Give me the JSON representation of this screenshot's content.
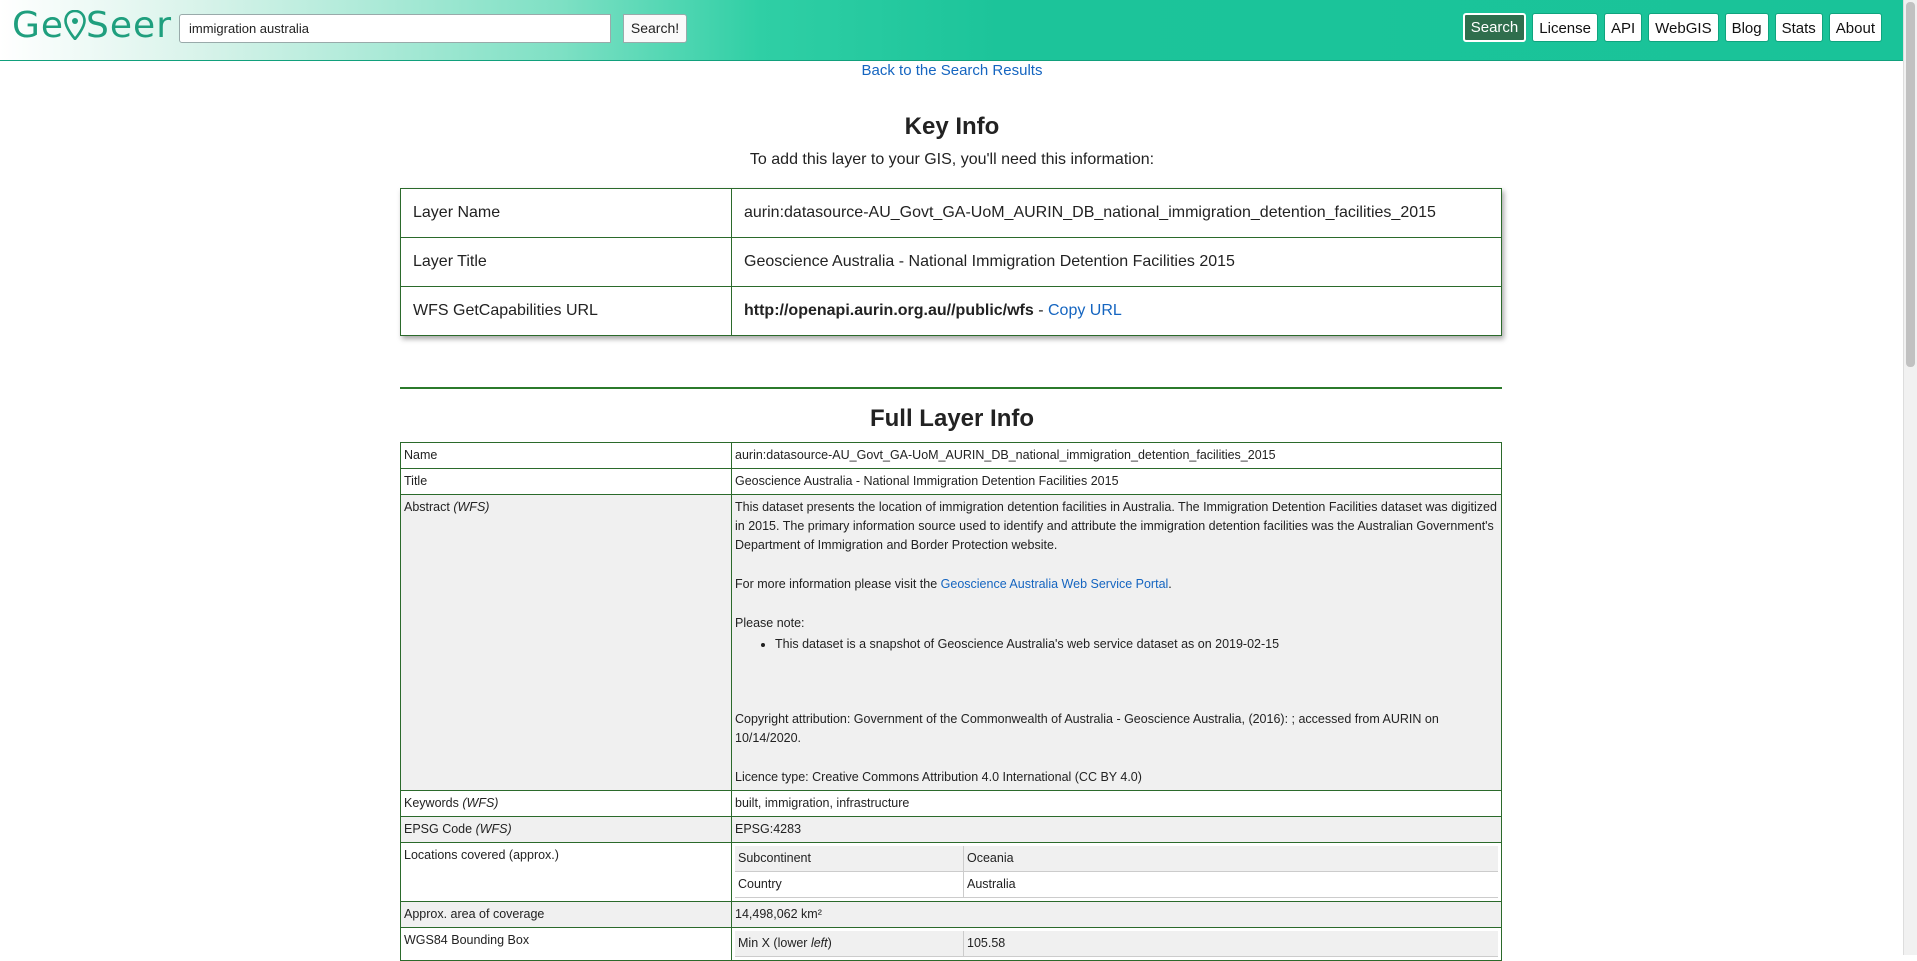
{
  "header": {
    "logo_prefix": "Ge",
    "logo_suffix": "Seer",
    "search_value": "immigration australia",
    "search_button": "Search!",
    "nav": [
      "Search",
      "License",
      "API",
      "WebGIS",
      "Blog",
      "Stats",
      "About"
    ],
    "active_nav": "Search",
    "accent": "#19c399"
  },
  "back_link": "Back to the Search Results",
  "key_info": {
    "title": "Key Info",
    "intro": "To add this layer to your GIS, you'll need this information:",
    "rows": {
      "layer_name_label": "Layer Name",
      "layer_name_value": "aurin:datasource-AU_Govt_GA-UoM_AURIN_DB_national_immigration_detention_facilities_2015",
      "layer_title_label": "Layer Title",
      "layer_title_value": "Geoscience Australia - National Immigration Detention Facilities 2015",
      "wfs_label": "WFS GetCapabilities URL",
      "wfs_url": "http://openapi.aurin.org.au//public/wfs",
      "wfs_sep": " - ",
      "copy_url": "Copy URL"
    }
  },
  "full_info": {
    "title": "Full Layer Info",
    "name_label": "Name",
    "name_value": "aurin:datasource-AU_Govt_GA-UoM_AURIN_DB_national_immigration_detention_facilities_2015",
    "title_label": "Title",
    "title_value": "Geoscience Australia - National Immigration Detention Facilities 2015",
    "abstract_label": "Abstract",
    "abstract_tag": "(WFS)",
    "abstract_p1": "This dataset presents the location of immigration detention facilities in Australia. The Immigration Detention Facilities dataset was digitized in 2015. The primary information source used to identify and attribute the immigration detention facilities was the Australian Government's Department of Immigration and Border Protection website.",
    "abstract_more_prefix": "For more information please visit the ",
    "abstract_more_link": "Geoscience Australia Web Service Portal",
    "abstract_more_suffix": ".",
    "abstract_note": "Please note:",
    "abstract_bullet": "This dataset is a snapshot of Geoscience Australia's web service dataset as on 2019-02-15",
    "abstract_copyright": "Copyright attribution: Government of the Commonwealth of Australia - Geoscience Australia, (2016): ; accessed from AURIN on 10/14/2020.",
    "abstract_licence": "Licence type: Creative Commons Attribution 4.0 International (CC BY 4.0)",
    "keywords_label": "Keywords",
    "keywords_tag": "(WFS)",
    "keywords_value": "built, immigration, infrastructure",
    "epsg_label": "EPSG Code",
    "epsg_tag": "(WFS)",
    "epsg_value": "EPSG:4283",
    "locations_label": "Locations covered (approx.)",
    "locations": [
      {
        "k": "Subcontinent",
        "v": "Oceania"
      },
      {
        "k": "Country",
        "v": "Australia"
      }
    ],
    "area_label": "Approx. area of coverage",
    "area_value": "14,498,062 km²",
    "bbox_label": "WGS84 Bounding Box",
    "bbox_minx_label": "Min X (lower ",
    "bbox_minx_em": "left",
    "bbox_minx_close": ")",
    "bbox_minx_value": "105.58"
  }
}
